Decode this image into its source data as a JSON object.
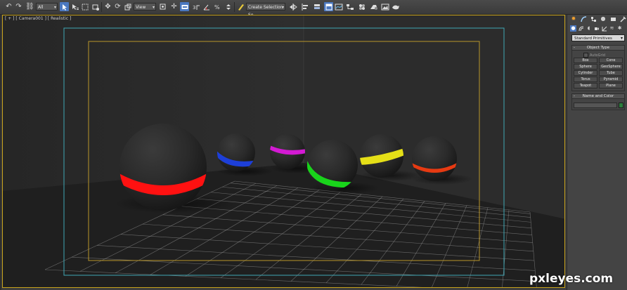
{
  "toolbar": {
    "selection_filter": "All",
    "reference_coord": "View",
    "named_selection_placeholder": "Create Selection Se",
    "icons": [
      "undo-icon",
      "redo-icon",
      "link-icon",
      "unlink-icon",
      "bind-space-warp-icon",
      "select-object-icon",
      "select-by-name-icon",
      "rect-region-icon",
      "window-crossing-icon",
      "move-icon",
      "rotate-icon",
      "scale-icon",
      "pivot-icon",
      "select-manipulate-icon",
      "keyboard-shortcut-icon",
      "snap-3d-icon",
      "angle-snap-icon",
      "percent-snap-icon",
      "spinner-snap-icon",
      "edit-named-sets-icon",
      "mirror-icon",
      "align-icon",
      "layer-explorer-icon",
      "toggle-ribbon-icon",
      "curve-editor-icon",
      "schematic-view-icon",
      "material-editor-icon",
      "render-setup-icon",
      "rendered-frame-icon",
      "render-production-icon"
    ]
  },
  "viewport": {
    "label": "[ + ] [ Camera001 ] [ Realistic ]",
    "colors": {
      "border": "#c7a21b",
      "safe_frame_outer": "#3fa7b5",
      "safe_frame_inner": "#b9962a",
      "grid": "#9a9a9a"
    },
    "spheres": [
      {
        "name": "large-sphere",
        "band_color": "#ff1111"
      },
      {
        "name": "blue-band-sphere",
        "band_color": "#1d3fd8"
      },
      {
        "name": "magenta-band-sphere",
        "band_color": "#d31ad3"
      },
      {
        "name": "green-band-sphere",
        "band_color": "#19d41b"
      },
      {
        "name": "yellow-band-sphere",
        "band_color": "#e5df17"
      },
      {
        "name": "orange-band-sphere",
        "band_color": "#e63a12"
      }
    ]
  },
  "command_panel": {
    "tabs": [
      "create-tab-icon",
      "modify-tab-icon",
      "hierarchy-tab-icon",
      "motion-tab-icon",
      "display-tab-icon",
      "utilities-tab-icon"
    ],
    "subtabs": [
      "geometry-icon",
      "shapes-icon",
      "lights-icon",
      "cameras-icon",
      "helpers-icon",
      "space-warps-icon",
      "systems-icon"
    ],
    "category": "Standard Primitives",
    "object_type": {
      "title": "Object Type",
      "autogrid_label": "AutoGrid",
      "buttons": [
        {
          "label": "Box"
        },
        {
          "label": "Cone"
        },
        {
          "label": "Sphere"
        },
        {
          "label": "GeoSphere"
        },
        {
          "label": "Cylinder"
        },
        {
          "label": "Tube"
        },
        {
          "label": "Torus"
        },
        {
          "label": "Pyramid"
        },
        {
          "label": "Teapot"
        },
        {
          "label": "Plane"
        }
      ]
    },
    "name_and_color": {
      "title": "Name and Color",
      "name_value": "",
      "color": "#2c7d3b"
    }
  },
  "watermark": "pxleyes.com"
}
